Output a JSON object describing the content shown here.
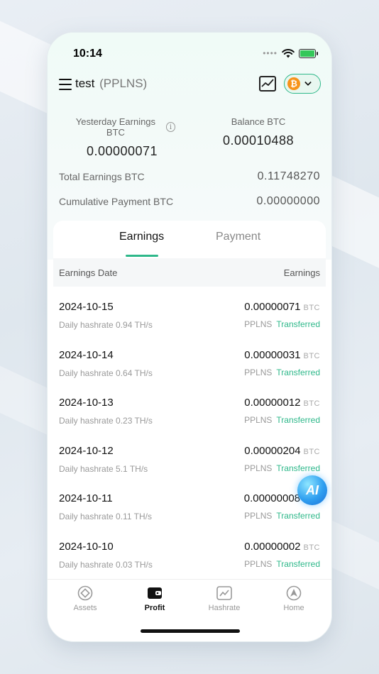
{
  "status_bar": {
    "time": "10:14",
    "signal_icon": "signal-dots-icon",
    "wifi_icon": "wifi-icon",
    "battery_icon": "battery-charging-icon"
  },
  "header": {
    "account_name": "test",
    "pool_mode": "(PPLNS)",
    "coin_symbol": "₿"
  },
  "summary": {
    "yesterday_label": "Yesterday Earnings BTC",
    "yesterday_value": "0.00000071",
    "balance_label": "Balance BTC",
    "balance_value": "0.00010488",
    "total_label": "Total Earnings BTC",
    "total_value": "0.11748270",
    "cumulative_label": "Cumulative Payment BTC",
    "cumulative_value": "0.00000000"
  },
  "tabs": {
    "earnings": "Earnings",
    "payment": "Payment"
  },
  "table": {
    "col_date": "Earnings Date",
    "col_earnings": "Earnings",
    "rows": [
      {
        "date": "2024-10-15",
        "hashrate": "Daily hashrate 0.94 TH/s",
        "amount": "0.00000071",
        "unit": "BTC",
        "mode": "PPLNS",
        "status": "Transferred"
      },
      {
        "date": "2024-10-14",
        "hashrate": "Daily hashrate 0.64 TH/s",
        "amount": "0.00000031",
        "unit": "BTC",
        "mode": "PPLNS",
        "status": "Transferred"
      },
      {
        "date": "2024-10-13",
        "hashrate": "Daily hashrate 0.23 TH/s",
        "amount": "0.00000012",
        "unit": "BTC",
        "mode": "PPLNS",
        "status": "Transferred"
      },
      {
        "date": "2024-10-12",
        "hashrate": "Daily hashrate 5.1 TH/s",
        "amount": "0.00000204",
        "unit": "BTC",
        "mode": "PPLNS",
        "status": "Transferred"
      },
      {
        "date": "2024-10-11",
        "hashrate": "Daily hashrate 0.11 TH/s",
        "amount": "0.00000008",
        "unit": "",
        "mode": "PPLNS",
        "status": "Transferred"
      },
      {
        "date": "2024-10-10",
        "hashrate": "Daily hashrate 0.03 TH/s",
        "amount": "0.00000002",
        "unit": "BTC",
        "mode": "PPLNS",
        "status": "Transferred"
      }
    ]
  },
  "ai_button": {
    "label": "AI"
  },
  "tabbar": {
    "assets": "Assets",
    "profit": "Profit",
    "hashrate": "Hashrate",
    "home": "Home"
  },
  "colors": {
    "accent": "#2eb88a",
    "btc": "#f7931a"
  }
}
